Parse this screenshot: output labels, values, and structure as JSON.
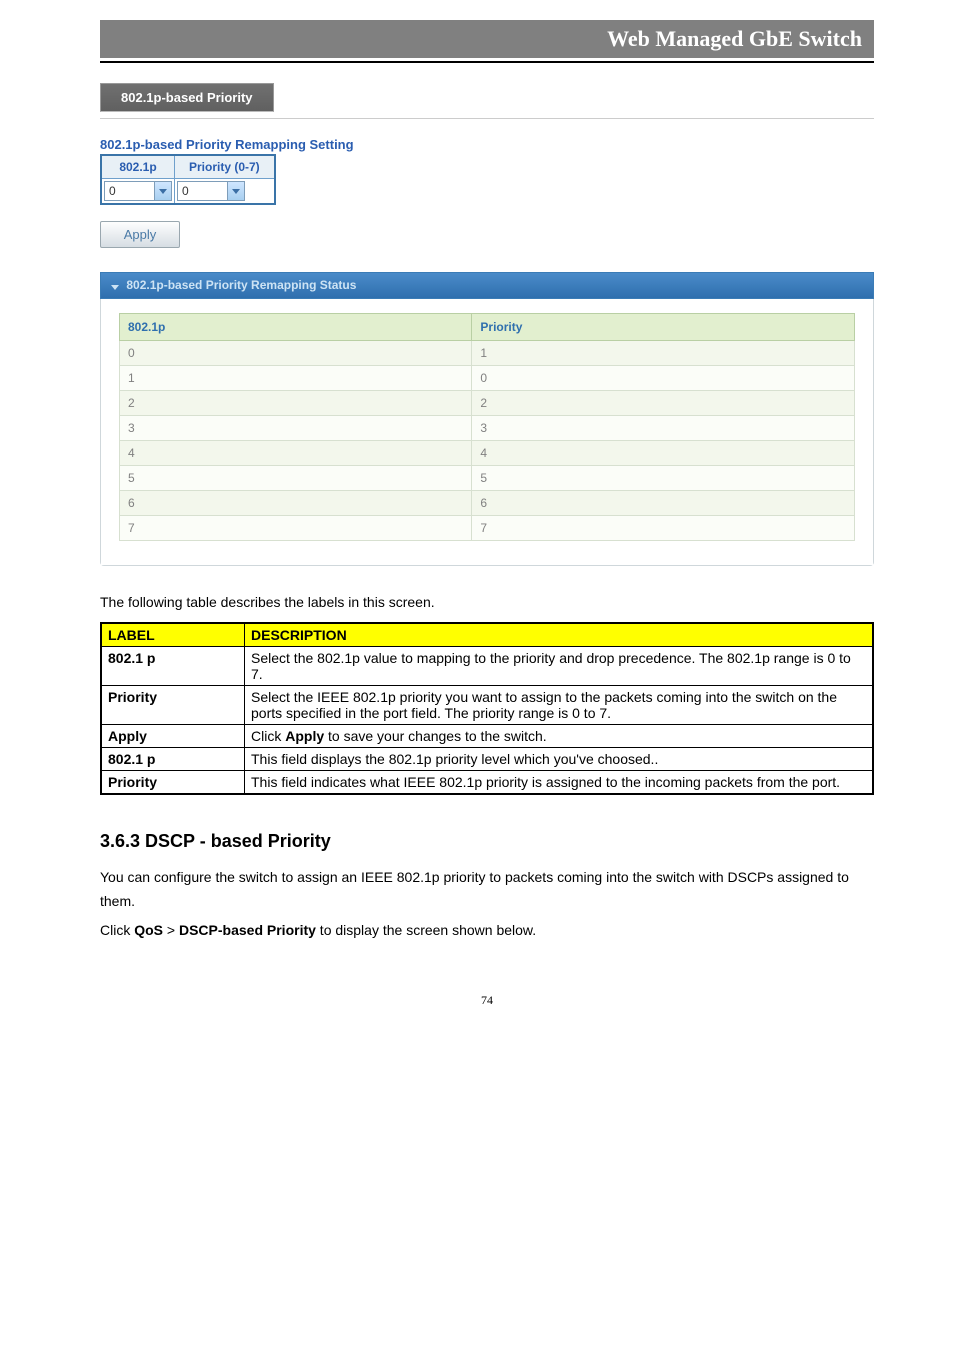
{
  "header": {
    "title": "Web Managed GbE Switch"
  },
  "tab": {
    "label": "802.1p-based Priority"
  },
  "setting": {
    "title": "802.1p-based Priority Remapping Setting",
    "col1": "802.1p",
    "col2": "Priority (0-7)",
    "val1": "0",
    "val2": "0"
  },
  "apply": {
    "label": "Apply"
  },
  "status": {
    "title": "802.1p-based Priority Remapping Status",
    "columns": {
      "c1": "802.1p",
      "c2": "Priority"
    },
    "rows": [
      {
        "p": "0",
        "prio": "1"
      },
      {
        "p": "1",
        "prio": "0"
      },
      {
        "p": "2",
        "prio": "2"
      },
      {
        "p": "3",
        "prio": "3"
      },
      {
        "p": "4",
        "prio": "4"
      },
      {
        "p": "5",
        "prio": "5"
      },
      {
        "p": "6",
        "prio": "6"
      },
      {
        "p": "7",
        "prio": "7"
      }
    ]
  },
  "intro": {
    "text": "The following table describes the labels in this screen."
  },
  "desc": {
    "head1": "LABEL",
    "head2": "DESCRIPTION",
    "rows": [
      {
        "label": "802.1 p",
        "text": "Select the 802.1p value to mapping to the priority and drop precedence. The 802.1p range is 0 to 7."
      },
      {
        "label": "Priority",
        "text": "Select the IEEE 802.1p priority you want to assign to the packets coming into the switch on the ports specified in the port field. The priority range is 0 to 7."
      },
      {
        "label": "Apply",
        "text_pre": "Click ",
        "text_bold": "Apply",
        "text_post": " to save your changes to the switch."
      },
      {
        "label": "802.1 p",
        "text": "This field displays the 802.1p priority level which you've choosed.."
      },
      {
        "label": "Priority",
        "text": "This field indicates what IEEE 802.1p priority is assigned to the incoming packets from the port."
      }
    ]
  },
  "section": {
    "heading": "3.6.3 DSCP - based Priority",
    "para1": "You can configure the switch to assign an IEEE 802.1p priority to packets coming into the switch with DSCPs assigned to them.",
    "para2_pre": "Click ",
    "para2_b1": "QoS",
    "para2_mid": " > ",
    "para2_b2": "DSCP-based Priority",
    "para2_post": " to display the screen shown below."
  },
  "page_number": "74"
}
